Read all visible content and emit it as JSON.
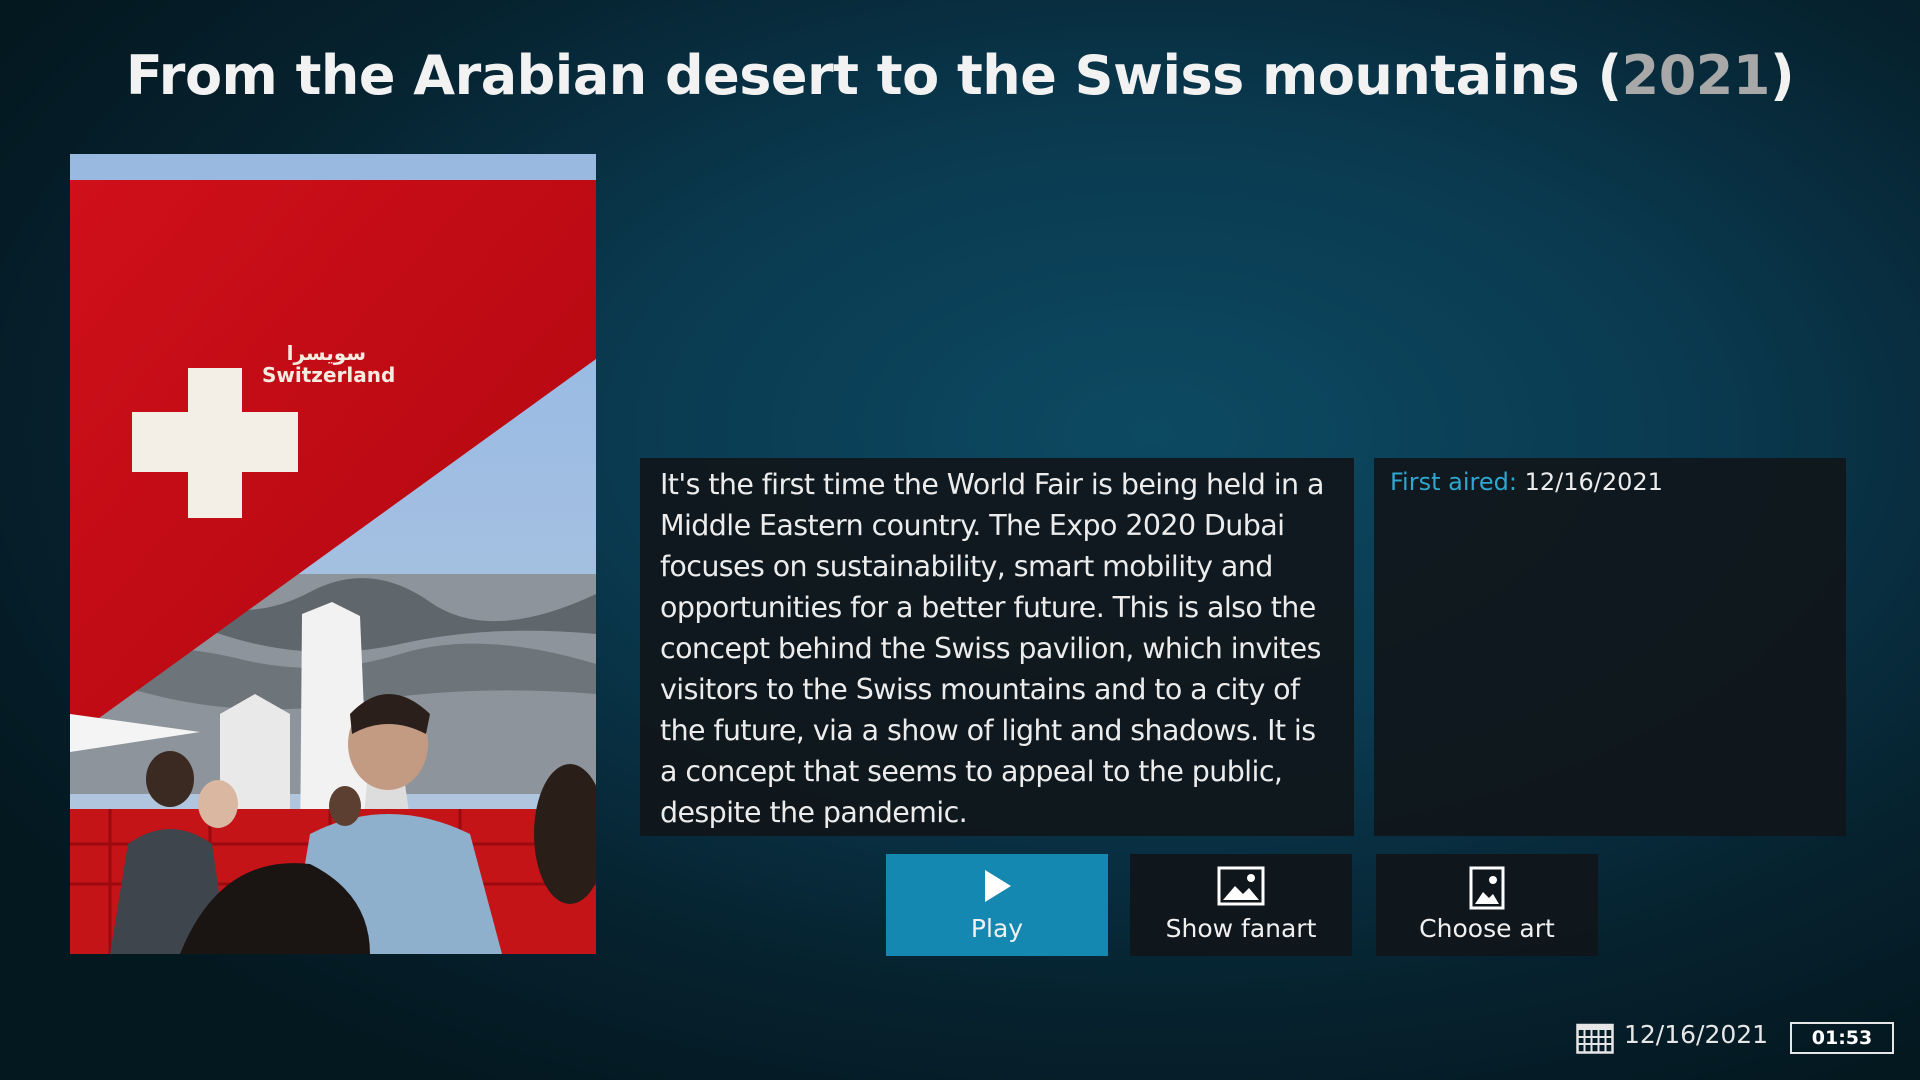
{
  "header": {
    "title": "From the Arabian desert to the Swiss mountains",
    "year": "2021"
  },
  "poster": {
    "caption_latin": "Switzerland",
    "caption_arabic": "سويسرا"
  },
  "plot": {
    "text": "It's the first time the World Fair is being held in a Middle Eastern country. The Expo 2020 Dubai focuses on sustainability, smart mobility and opportunities for a better future. This is also the concept behind the Swiss pavilion, which invites visitors to the Swiss mountains and to a city of the future, via a show of light and shadows. It is a concept that seems to appeal to the public, despite the pandemic."
  },
  "info": {
    "first_aired_label": "First aired:",
    "first_aired_value": "12/16/2021"
  },
  "buttons": [
    {
      "label": "Play",
      "icon": "play-icon",
      "focused": true
    },
    {
      "label": "Show fanart",
      "icon": "fanart-icon",
      "focused": false
    },
    {
      "label": "Choose art",
      "icon": "choose-art-icon",
      "focused": false
    }
  ],
  "status": {
    "date": "12/16/2021",
    "time": "01:53",
    "calendar_icon": "calendar-icon"
  },
  "colors": {
    "accent": "#1488b0",
    "label_blue": "#2ea6cf",
    "panel": "#10161a"
  }
}
